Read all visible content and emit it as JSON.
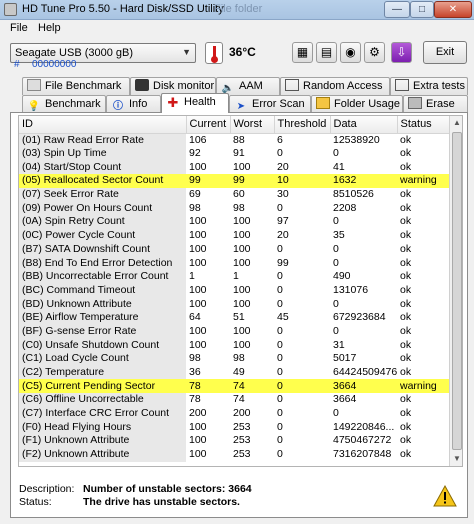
{
  "window": {
    "title": "HD Tune Pro 5.50 - Hard Disk/SSD Utility",
    "background_title": "File folder"
  },
  "menu": {
    "file": "File",
    "help": "Help"
  },
  "toolbar": {
    "drive": "Seagate USB (3000 gB)",
    "hash": "#",
    "serial": "00000000",
    "temperature": "36°C",
    "exit": "Exit"
  },
  "tabs_top": [
    {
      "label": "File Benchmark",
      "icon": "file-benchmark-icon"
    },
    {
      "label": "Disk monitor",
      "icon": "disk-monitor-icon"
    },
    {
      "label": "AAM",
      "icon": "speaker-icon"
    },
    {
      "label": "Random Access",
      "icon": "random-access-icon"
    },
    {
      "label": "Extra tests",
      "icon": "extra-tests-icon"
    }
  ],
  "tabs_bottom": [
    {
      "label": "Benchmark",
      "icon": "benchmark-icon"
    },
    {
      "label": "Info",
      "icon": "info-icon"
    },
    {
      "label": "Health",
      "icon": "health-icon",
      "active": true
    },
    {
      "label": "Error Scan",
      "icon": "error-scan-icon"
    },
    {
      "label": "Folder Usage",
      "icon": "folder-usage-icon"
    },
    {
      "label": "Erase",
      "icon": "erase-icon"
    }
  ],
  "table": {
    "headers": [
      "ID",
      "Current",
      "Worst",
      "Threshold",
      "Data",
      "Status"
    ],
    "rows": [
      [
        "(01) Raw Read Error Rate",
        "106",
        "88",
        "6",
        "12538920",
        "ok"
      ],
      [
        "(03) Spin Up Time",
        "92",
        "91",
        "0",
        "0",
        "ok"
      ],
      [
        "(04) Start/Stop Count",
        "100",
        "100",
        "20",
        "41",
        "ok"
      ],
      [
        "(05) Reallocated Sector Count",
        "99",
        "99",
        "10",
        "1632",
        "warning"
      ],
      [
        "(07) Seek Error Rate",
        "69",
        "60",
        "30",
        "8510526",
        "ok"
      ],
      [
        "(09) Power On Hours Count",
        "98",
        "98",
        "0",
        "2208",
        "ok"
      ],
      [
        "(0A) Spin Retry Count",
        "100",
        "100",
        "97",
        "0",
        "ok"
      ],
      [
        "(0C) Power Cycle Count",
        "100",
        "100",
        "20",
        "35",
        "ok"
      ],
      [
        "(B7) SATA Downshift Count",
        "100",
        "100",
        "0",
        "0",
        "ok"
      ],
      [
        "(B8) End To End Error Detection",
        "100",
        "100",
        "99",
        "0",
        "ok"
      ],
      [
        "(BB) Uncorrectable Error Count",
        "1",
        "1",
        "0",
        "490",
        "ok"
      ],
      [
        "(BC) Command Timeout",
        "100",
        "100",
        "0",
        "131076",
        "ok"
      ],
      [
        "(BD) Unknown Attribute",
        "100",
        "100",
        "0",
        "0",
        "ok"
      ],
      [
        "(BE) Airflow Temperature",
        "64",
        "51",
        "45",
        "672923684",
        "ok"
      ],
      [
        "(BF) G-sense Error Rate",
        "100",
        "100",
        "0",
        "0",
        "ok"
      ],
      [
        "(C0) Unsafe Shutdown Count",
        "100",
        "100",
        "0",
        "31",
        "ok"
      ],
      [
        "(C1) Load Cycle Count",
        "98",
        "98",
        "0",
        "5017",
        "ok"
      ],
      [
        "(C2) Temperature",
        "36",
        "49",
        "0",
        "64424509476",
        "ok"
      ],
      [
        "(C5) Current Pending Sector",
        "78",
        "74",
        "0",
        "3664",
        "warning"
      ],
      [
        "(C6) Offline Uncorrectable",
        "78",
        "74",
        "0",
        "3664",
        "ok"
      ],
      [
        "(C7) Interface CRC Error Count",
        "200",
        "200",
        "0",
        "0",
        "ok"
      ],
      [
        "(F0) Head Flying Hours",
        "100",
        "253",
        "0",
        "149220846...",
        "ok"
      ],
      [
        "(F1) Unknown Attribute",
        "100",
        "253",
        "0",
        "4750467272",
        "ok"
      ],
      [
        "(F2) Unknown Attribute",
        "100",
        "253",
        "0",
        "7316207848",
        "ok"
      ]
    ],
    "warning_color": "#ffff4d"
  },
  "footer": {
    "description_label": "Description:",
    "description_value": "Number of unstable sectors: 3664",
    "status_label": "Status:",
    "status_value": "The drive has unstable sectors."
  }
}
